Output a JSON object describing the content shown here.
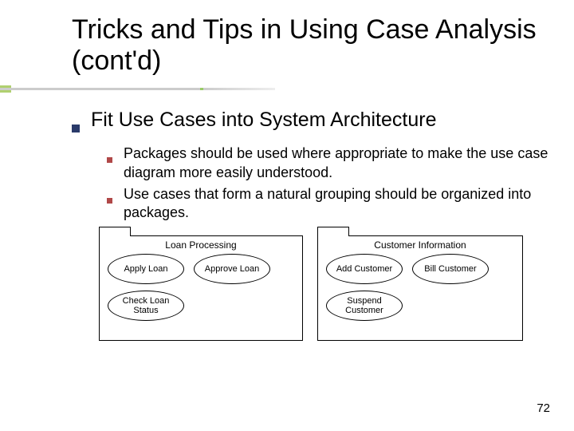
{
  "title": "Tricks and Tips in Using Case Analysis (cont'd)",
  "heading": "Fit Use Cases into System Architecture",
  "bullets": [
    "Packages should be used where appropriate to make the use case diagram more easily understood.",
    "Use cases that form a natural grouping should be organized into packages."
  ],
  "packages": [
    {
      "name": "Loan Processing",
      "usecases_row1": [
        "Apply Loan",
        "Approve Loan"
      ],
      "usecases_row2": [
        "Check Loan Status"
      ]
    },
    {
      "name": "Customer Information",
      "usecases_row1": [
        "Add Customer",
        "Bill Customer"
      ],
      "usecases_row2": [
        "Suspend Customer"
      ]
    }
  ],
  "page_number": "72"
}
